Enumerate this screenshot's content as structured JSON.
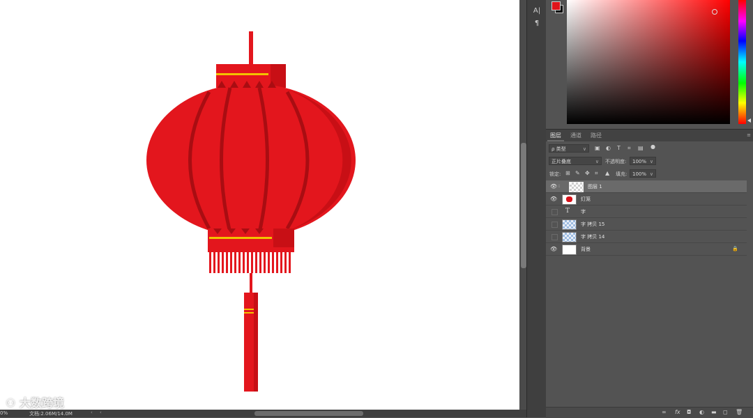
{
  "canvas": {
    "background": "#ffffff"
  },
  "status": {
    "zoom": "0%",
    "doc": "文档:2.06M/14.0M",
    "scroll_left": "‹",
    "scroll_right": "›"
  },
  "toolstrip": {
    "char_tool": "A|",
    "para_tool": "¶"
  },
  "colors": {
    "foreground": "#e0141a",
    "background": "#000000",
    "lantern_red": "#e3161d",
    "lantern_dark": "#a90d12",
    "gold": "#f2c200"
  },
  "panel": {
    "tabs": [
      {
        "label": "图层"
      },
      {
        "label": "通道"
      },
      {
        "label": "路径"
      }
    ],
    "filter": {
      "label": "ρ 类型",
      "caret": "∨"
    },
    "blend": {
      "label": "正片叠底",
      "caret": "∨"
    },
    "opacity": {
      "label": "不透明度:",
      "value": "100%",
      "caret": "∨"
    },
    "lock": {
      "label": "锁定:"
    },
    "fill": {
      "label": "填充:",
      "value": "100%",
      "caret": "∨"
    },
    "layers": [
      {
        "name": "图层 1",
        "visible": true,
        "selected": true,
        "thumb": "sel"
      },
      {
        "name": "灯笼",
        "visible": true,
        "selected": false,
        "thumb": "lantern-t"
      },
      {
        "name": "字",
        "visible": false,
        "selected": false,
        "thumb": "type"
      },
      {
        "name": "字 拷贝 15",
        "visible": false,
        "selected": false,
        "thumb": "blue"
      },
      {
        "name": "字 拷贝 14",
        "visible": false,
        "selected": false,
        "thumb": "blue"
      },
      {
        "name": "背景",
        "visible": true,
        "selected": false,
        "thumb": "white",
        "locked": true
      }
    ]
  },
  "watermark": {
    "text": "大数跨境"
  }
}
